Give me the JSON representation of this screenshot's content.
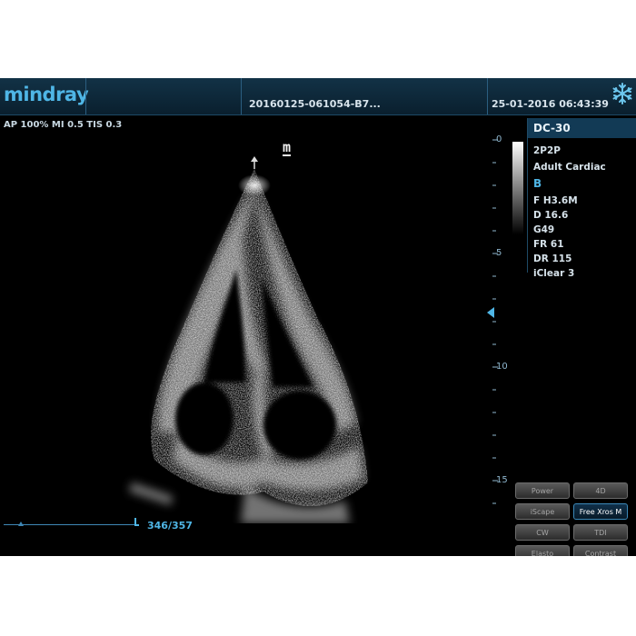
{
  "header": {
    "logo": "mindray",
    "patient_id": "20160125-061054-B7...",
    "datetime": "25-01-2016 06:43:39",
    "freeze_icon": "snowflake-icon"
  },
  "acoustic": {
    "line": "AP 100%  MI 0.5 TIS 0.3"
  },
  "image": {
    "orientation_marker": "m"
  },
  "depth_scale": {
    "unit": "cm",
    "labels": [
      "0",
      "5",
      "10",
      "15"
    ]
  },
  "params": {
    "probe": "DC-30",
    "preset": "2P2P",
    "exam": "Adult Cardiac",
    "mode": "B",
    "freq": "F H3.6M",
    "depth": "D 16.6",
    "gain": "G49",
    "frame_rate": "FR 61",
    "dynamic_range": "DR 115",
    "iclear": "iClear 3"
  },
  "soft_buttons": [
    {
      "label": "Power",
      "active": false
    },
    {
      "label": "4D",
      "active": false
    },
    {
      "label": "iScape",
      "active": false
    },
    {
      "label": "Free Xros M",
      "active": true
    },
    {
      "label": "CW",
      "active": false
    },
    {
      "label": "TDI",
      "active": false
    },
    {
      "label": "Elasto",
      "active": false
    },
    {
      "label": "Contrast",
      "active": false
    }
  ],
  "cine": {
    "frames": "346/357"
  },
  "colors": {
    "accent": "#4fb6e6",
    "header_bg": "#123246",
    "active_button_border": "#3b88b8"
  }
}
